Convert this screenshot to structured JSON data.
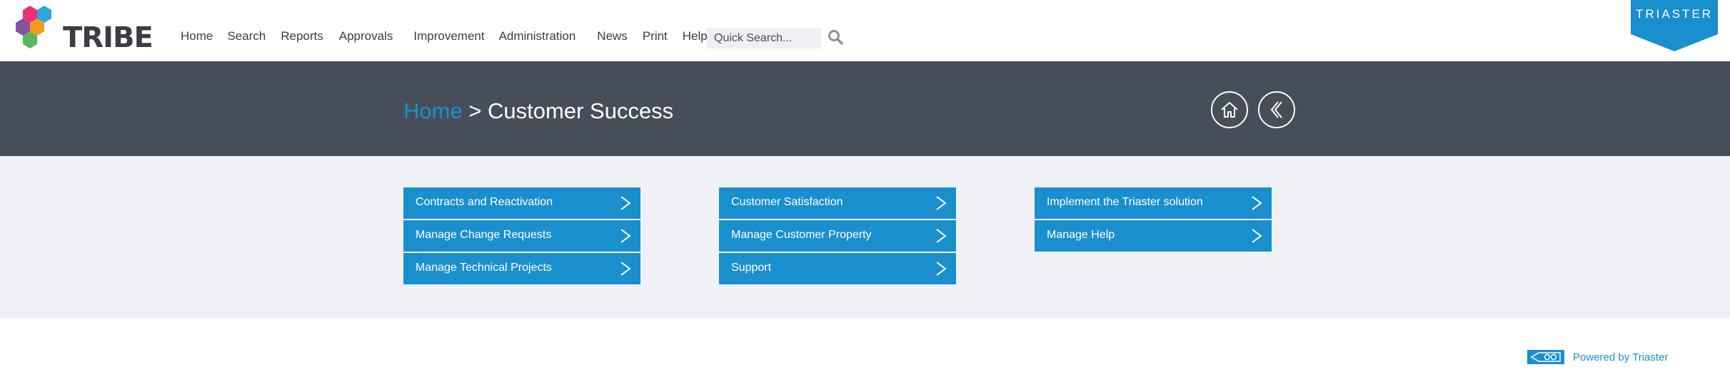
{
  "header": {
    "logo_text": "TRIBE",
    "nav": [
      "Home",
      "Search",
      "Reports",
      "Approvals",
      "Improvement",
      "Administration",
      "News",
      "Print",
      "Help"
    ],
    "search_placeholder": "Quick Search...",
    "brand_badge": "TRIASTER"
  },
  "banner": {
    "crumb_home": "Home",
    "crumb_separator": " > ",
    "crumb_current": "Customer Success"
  },
  "tiles": [
    [
      "Contracts and Reactivation",
      "Manage Change Requests",
      "Manage Technical Projects"
    ],
    [
      "Customer Satisfaction",
      "Manage Customer Property",
      "Support"
    ],
    [
      "Implement the Triaster solution",
      "Manage Help"
    ]
  ],
  "footer": {
    "powered_text": "Powered by Triaster"
  },
  "colors": {
    "accent": "#1a8fce",
    "banner": "#474e5a",
    "tile_area": "#eff1f6",
    "text_dark": "#3a3d44"
  },
  "icons": {
    "search": "search-icon",
    "home": "home-icon",
    "back": "back-icon",
    "chevron": "chevron-right-icon"
  }
}
